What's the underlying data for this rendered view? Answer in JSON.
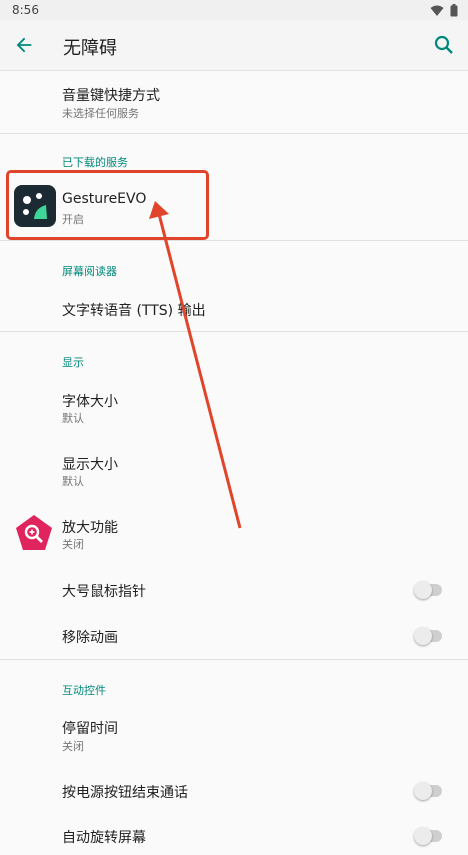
{
  "status_bar": {
    "time": "8:56"
  },
  "app_bar": {
    "title": "无障碍"
  },
  "items": {
    "volume_shortcut": {
      "title": "音量键快捷方式",
      "subtitle": "未选择任何服务"
    },
    "downloaded_section": "已下载的服务",
    "gesture_evo": {
      "title": "GestureEVO",
      "subtitle": "开启"
    },
    "screen_reader_section": "屏幕阅读器",
    "tts": {
      "title": "文字转语音 (TTS) 输出"
    },
    "display_section": "显示",
    "font_size": {
      "title": "字体大小",
      "subtitle": "默认"
    },
    "display_size": {
      "title": "显示大小",
      "subtitle": "默认"
    },
    "magnification": {
      "title": "放大功能",
      "subtitle": "关闭"
    },
    "large_pointer": {
      "title": "大号鼠标指针",
      "enabled": false
    },
    "remove_animations": {
      "title": "移除动画",
      "enabled": false
    },
    "interaction_section": "互动控件",
    "dwell_time": {
      "title": "停留时间",
      "subtitle": "关闭"
    },
    "power_button_ends_call": {
      "title": "按电源按钮结束通话",
      "enabled": false
    },
    "partial_item": {
      "title": "自动旋转屏幕",
      "enabled": false
    }
  },
  "colors": {
    "accent": "#00897b",
    "annotation": "#e0452c",
    "magnify_icon": "#e0245e"
  }
}
